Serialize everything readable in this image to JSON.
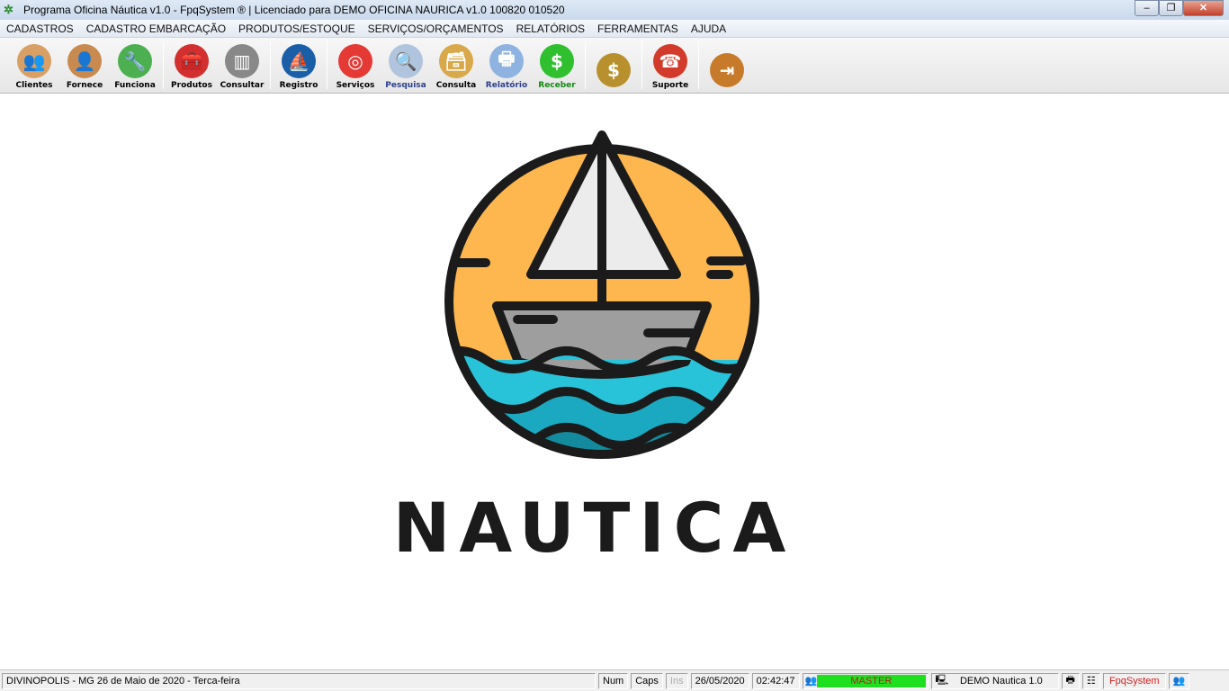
{
  "window": {
    "title": "Programa Oficina Náutica v1.0 - FpqSystem ® | Licenciado para  DEMO OFICINA NAURICA v1.0 100820 010520"
  },
  "menu": [
    "CADASTROS",
    "CADASTRO EMBARCAÇÃO",
    "PRODUTOS/ESTOQUE",
    "SERVIÇOS/ORÇAMENTOS",
    "RELATÓRIOS",
    "FERRAMENTAS",
    "AJUDA"
  ],
  "toolbar": [
    {
      "label": "Clientes",
      "icon": "users-icon",
      "color": "#000",
      "bg": "#d9a066"
    },
    {
      "label": "Fornece",
      "icon": "supplier-icon",
      "color": "#000",
      "bg": "#c98a50"
    },
    {
      "label": "Funciona",
      "icon": "employee-icon",
      "color": "#000",
      "bg": "#4caf50"
    },
    {
      "label": "Produtos",
      "icon": "toolbox-icon",
      "color": "#000",
      "bg": "#d32f2f"
    },
    {
      "label": "Consultar",
      "icon": "barcode-icon",
      "color": "#000",
      "bg": "#888"
    },
    {
      "label": "Registro",
      "icon": "sailboat-icon",
      "color": "#000",
      "bg": "#1a5ea8"
    },
    {
      "label": "Serviços",
      "icon": "lifebuoy-icon",
      "color": "#000",
      "bg": "#e53935"
    },
    {
      "label": "Pesquisa",
      "icon": "search-doc-icon",
      "color": "#2b3f8c",
      "bg": "#b0c4de"
    },
    {
      "label": "Consulta",
      "icon": "file-box-icon",
      "color": "#000",
      "bg": "#d9a84a"
    },
    {
      "label": "Relatório",
      "icon": "printer-icon",
      "color": "#2b3f8c",
      "bg": "#8fb3e0"
    },
    {
      "label": "Receber",
      "icon": "dollar-icon",
      "color": "#138a13",
      "bg": "#2fbf2f"
    },
    {
      "label": "",
      "icon": "coins-icon",
      "color": "#000",
      "bg": "#b8902e"
    },
    {
      "label": "Suporte",
      "icon": "support-icon",
      "color": "#000",
      "bg": "#d23b2b"
    },
    {
      "label": "",
      "icon": "exit-icon",
      "color": "#000",
      "bg": "#c77b2a"
    }
  ],
  "logo": {
    "text": "NAUTICA"
  },
  "status": {
    "location": "DIVINOPOLIS - MG 26 de Maio de 2020 - Terca-feira",
    "num": "Num",
    "caps": "Caps",
    "ins": "Ins",
    "date": "26/05/2020",
    "time": "02:42:47",
    "user": "MASTER",
    "version": "DEMO Nautica 1.0",
    "brand": "FpqSystem"
  }
}
